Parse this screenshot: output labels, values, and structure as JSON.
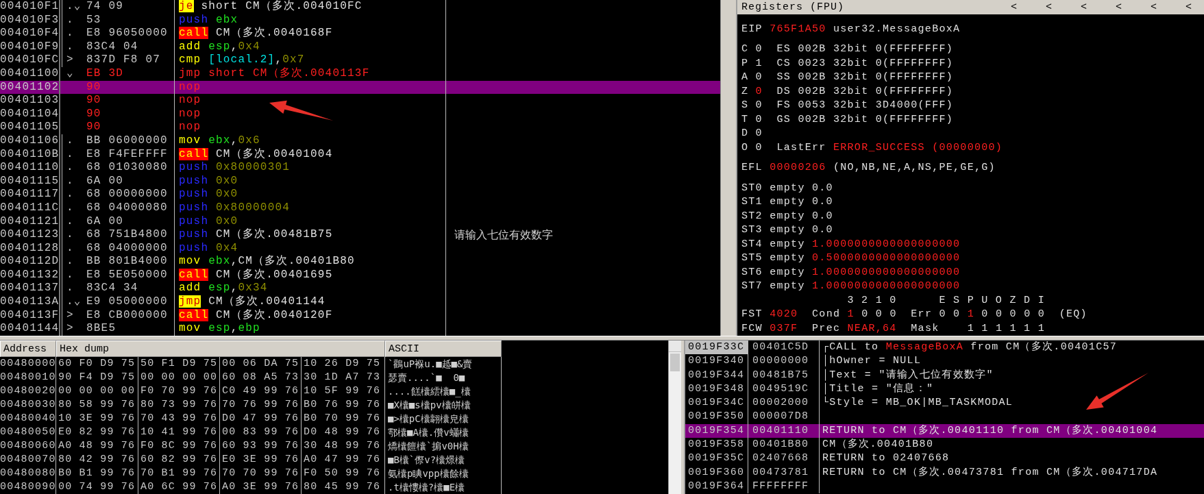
{
  "disasm": {
    "rows": [
      {
        "address": "004010F1",
        "mark": ".⌄",
        "bracket": true,
        "hex": "74 09",
        "modified": false,
        "selected": false,
        "tokens": [
          {
            "text": "je",
            "kind": "jump"
          },
          {
            "text": " short CM（多次.004010FC",
            "kind": "plain"
          }
        ]
      },
      {
        "address": "004010F3",
        "mark": ".",
        "bracket": true,
        "hex": "53",
        "modified": false,
        "selected": false,
        "tokens": [
          {
            "text": "push",
            "kind": "push"
          },
          {
            "text": " ebx",
            "kind": "reg"
          }
        ]
      },
      {
        "address": "004010F4",
        "mark": ".",
        "bracket": true,
        "hex": "E8 96050000",
        "modified": false,
        "selected": false,
        "tokens": [
          {
            "text": "call",
            "kind": "call"
          },
          {
            "text": " CM（多次.0040168F",
            "kind": "plain"
          }
        ]
      },
      {
        "address": "004010F9",
        "mark": ".",
        "bracket": true,
        "hex": "83C4 04",
        "modified": false,
        "selected": false,
        "tokens": [
          {
            "text": "add",
            "kind": "mnem"
          },
          {
            "text": " esp",
            "kind": "reg"
          },
          {
            "text": ",",
            "kind": "plain"
          },
          {
            "text": "0x4",
            "kind": "imm"
          }
        ]
      },
      {
        "address": "004010FC",
        "mark": ">",
        "bracket": true,
        "hex": "837D F8 07",
        "modified": false,
        "selected": false,
        "tokens": [
          {
            "text": "cmp",
            "kind": "mnem"
          },
          {
            "text": " [local.2]",
            "kind": "mem"
          },
          {
            "text": ",",
            "kind": "plain"
          },
          {
            "text": "0x7",
            "kind": "imm"
          }
        ]
      },
      {
        "address": "00401100",
        "mark": "⌄",
        "bracket": false,
        "hex": "EB 3D",
        "modified": true,
        "selected": false,
        "tokens": [
          {
            "text": "jmp short CM（多次.0040113F",
            "kind": "mod"
          }
        ]
      },
      {
        "address": "00401102",
        "bracket": false,
        "hex": "90",
        "modified": true,
        "selected": true,
        "tokens": [
          {
            "text": "nop",
            "kind": "mod"
          }
        ]
      },
      {
        "address": "00401103",
        "bracket": false,
        "hex": "90",
        "modified": true,
        "selected": false,
        "tokens": [
          {
            "text": "nop",
            "kind": "mod"
          }
        ]
      },
      {
        "address": "00401104",
        "bracket": false,
        "hex": "90",
        "modified": true,
        "selected": false,
        "tokens": [
          {
            "text": "nop",
            "kind": "mod"
          }
        ]
      },
      {
        "address": "00401105",
        "bracket": false,
        "hex": "90",
        "modified": true,
        "selected": false,
        "tokens": [
          {
            "text": "nop",
            "kind": "mod"
          }
        ]
      },
      {
        "address": "00401106",
        "mark": ".",
        "bracket": true,
        "hex": "BB 06000000",
        "modified": false,
        "selected": false,
        "tokens": [
          {
            "text": "mov",
            "kind": "mnem"
          },
          {
            "text": " ebx",
            "kind": "reg"
          },
          {
            "text": ",",
            "kind": "plain"
          },
          {
            "text": "0x6",
            "kind": "imm"
          }
        ]
      },
      {
        "address": "0040110B",
        "mark": ".",
        "bracket": true,
        "hex": "E8 F4FEFFFF",
        "modified": false,
        "selected": false,
        "tokens": [
          {
            "text": "call",
            "kind": "call"
          },
          {
            "text": " CM（多次.00401004",
            "kind": "plain"
          }
        ]
      },
      {
        "address": "00401110",
        "mark": ".",
        "bracket": true,
        "hex": "68 01030080",
        "modified": false,
        "selected": false,
        "tokens": [
          {
            "text": "push",
            "kind": "push"
          },
          {
            "text": " 0x80000301",
            "kind": "imm"
          }
        ]
      },
      {
        "address": "00401115",
        "mark": ".",
        "bracket": true,
        "hex": "6A 00",
        "modified": false,
        "selected": false,
        "tokens": [
          {
            "text": "push",
            "kind": "push"
          },
          {
            "text": " 0x0",
            "kind": "imm"
          }
        ]
      },
      {
        "address": "00401117",
        "mark": ".",
        "bracket": true,
        "hex": "68 00000000",
        "modified": false,
        "selected": false,
        "tokens": [
          {
            "text": "push",
            "kind": "push"
          },
          {
            "text": " 0x0",
            "kind": "imm"
          }
        ]
      },
      {
        "address": "0040111C",
        "mark": ".",
        "bracket": true,
        "hex": "68 04000080",
        "modified": false,
        "selected": false,
        "tokens": [
          {
            "text": "push",
            "kind": "push"
          },
          {
            "text": " 0x80000004",
            "kind": "imm"
          }
        ]
      },
      {
        "address": "00401121",
        "mark": ".",
        "bracket": true,
        "hex": "6A 00",
        "modified": false,
        "selected": false,
        "tokens": [
          {
            "text": "push",
            "kind": "push"
          },
          {
            "text": " 0x0",
            "kind": "imm"
          }
        ]
      },
      {
        "address": "00401123",
        "mark": ".",
        "bracket": true,
        "hex": "68 751B4800",
        "modified": false,
        "selected": false,
        "tokens": [
          {
            "text": "push",
            "kind": "push"
          },
          {
            "text": " CM（多次.00481B75",
            "kind": "plain"
          }
        ],
        "comment": "请输入七位有效数字"
      },
      {
        "address": "00401128",
        "mark": ".",
        "bracket": true,
        "hex": "68 04000000",
        "modified": false,
        "selected": false,
        "tokens": [
          {
            "text": "push",
            "kind": "push"
          },
          {
            "text": " 0x4",
            "kind": "imm"
          }
        ]
      },
      {
        "address": "0040112D",
        "mark": ".",
        "bracket": true,
        "hex": "BB 801B4000",
        "modified": false,
        "selected": false,
        "tokens": [
          {
            "text": "mov",
            "kind": "mnem"
          },
          {
            "text": " ebx",
            "kind": "reg"
          },
          {
            "text": ",CM（多次.00401B80",
            "kind": "plain"
          }
        ]
      },
      {
        "address": "00401132",
        "mark": ".",
        "bracket": true,
        "hex": "E8 5E050000",
        "modified": false,
        "selected": false,
        "tokens": [
          {
            "text": "call",
            "kind": "call"
          },
          {
            "text": " CM（多次.00401695",
            "kind": "plain"
          }
        ]
      },
      {
        "address": "00401137",
        "mark": ".",
        "bracket": true,
        "hex": "83C4 34",
        "modified": false,
        "selected": false,
        "tokens": [
          {
            "text": "add",
            "kind": "mnem"
          },
          {
            "text": " esp",
            "kind": "reg"
          },
          {
            "text": ",",
            "kind": "plain"
          },
          {
            "text": "0x34",
            "kind": "imm"
          }
        ]
      },
      {
        "address": "0040113A",
        "mark": ".⌄",
        "bracket": true,
        "hex": "E9 05000000",
        "modified": false,
        "selected": false,
        "tokens": [
          {
            "text": "jmp",
            "kind": "jump"
          },
          {
            "text": " CM（多次.00401144",
            "kind": "plain"
          }
        ]
      },
      {
        "address": "0040113F",
        "mark": ">",
        "bracket": true,
        "hex": "E8 CB000000",
        "modified": false,
        "selected": false,
        "tokens": [
          {
            "text": "call",
            "kind": "call"
          },
          {
            "text": " CM（多次.0040120F",
            "kind": "plain"
          }
        ]
      },
      {
        "address": "00401144",
        "mark": ">",
        "bracket": true,
        "hex": "8BE5",
        "modified": false,
        "selected": false,
        "tokens": [
          {
            "text": "mov",
            "kind": "mnem"
          },
          {
            "text": " esp",
            "kind": "reg"
          },
          {
            "text": ",",
            "kind": "plain"
          },
          {
            "text": "ebp",
            "kind": "reg"
          }
        ]
      }
    ]
  },
  "registers": {
    "title": "Registers (FPU)",
    "header_buttons": [
      "<",
      "<",
      "<",
      "<",
      "<",
      "<"
    ],
    "groups": [
      [
        [
          {
            "text": "EIP ",
            "kind": "plain"
          },
          {
            "text": "765F1A50",
            "kind": "changed"
          },
          {
            "text": " user32.MessageBoxA",
            "kind": "plain"
          }
        ]
      ],
      [
        [
          {
            "text": "C 0  ES 002B 32bit 0(FFFFFFFF)",
            "kind": "plain"
          }
        ],
        [
          {
            "text": "P 1  CS 0023 32bit 0(FFFFFFFF)",
            "kind": "plain"
          }
        ],
        [
          {
            "text": "A 0  SS 002B 32bit 0(FFFFFFFF)",
            "kind": "plain"
          }
        ],
        [
          {
            "text": "Z ",
            "kind": "plain"
          },
          {
            "text": "0",
            "kind": "changed"
          },
          {
            "text": "  DS 002B 32bit 0(FFFFFFFF)",
            "kind": "plain"
          }
        ],
        [
          {
            "text": "S 0  FS 0053 32bit 3D4000(FFF)",
            "kind": "plain"
          }
        ],
        [
          {
            "text": "T 0  GS 002B 32bit 0(FFFFFFFF)",
            "kind": "plain"
          }
        ],
        [
          {
            "text": "D 0",
            "kind": "plain"
          }
        ],
        [
          {
            "text": "O 0  LastErr ",
            "kind": "plain"
          },
          {
            "text": "ERROR_SUCCESS (00000000)",
            "kind": "changed"
          }
        ]
      ],
      [
        [
          {
            "text": "EFL ",
            "kind": "plain"
          },
          {
            "text": "00000206",
            "kind": "changed"
          },
          {
            "text": " (NO,NB,NE,A,NS,PE,GE,G)",
            "kind": "plain"
          }
        ]
      ],
      [
        [
          {
            "text": "ST0 empty 0.0",
            "kind": "plain"
          }
        ],
        [
          {
            "text": "ST1 empty 0.0",
            "kind": "plain"
          }
        ],
        [
          {
            "text": "ST2 empty 0.0",
            "kind": "plain"
          }
        ],
        [
          {
            "text": "ST3 empty 0.0",
            "kind": "plain"
          }
        ],
        [
          {
            "text": "ST4 empty ",
            "kind": "plain"
          },
          {
            "text": "1.0000000000000000000",
            "kind": "changed"
          }
        ],
        [
          {
            "text": "ST5 empty ",
            "kind": "plain"
          },
          {
            "text": "0.5000000000000000000",
            "kind": "changed"
          }
        ],
        [
          {
            "text": "ST6 empty ",
            "kind": "plain"
          },
          {
            "text": "1.0000000000000000000",
            "kind": "changed"
          }
        ],
        [
          {
            "text": "ST7 empty ",
            "kind": "plain"
          },
          {
            "text": "1.0000000000000000000",
            "kind": "changed"
          }
        ],
        [
          {
            "text": "               3 2 1 0      E S P U O Z D I",
            "kind": "plain"
          }
        ],
        [
          {
            "text": "FST ",
            "kind": "plain"
          },
          {
            "text": "4020",
            "kind": "changed"
          },
          {
            "text": "  Cond ",
            "kind": "plain"
          },
          {
            "text": "1",
            "kind": "changed"
          },
          {
            "text": " 0 0 0  Err 0 0 ",
            "kind": "plain"
          },
          {
            "text": "1",
            "kind": "changed"
          },
          {
            "text": " 0 0 0 0 0  (EQ)",
            "kind": "plain"
          }
        ],
        [
          {
            "text": "FCW ",
            "kind": "plain"
          },
          {
            "text": "037F",
            "kind": "changed"
          },
          {
            "text": "  Prec ",
            "kind": "plain"
          },
          {
            "text": "NEAR,64",
            "kind": "changed"
          },
          {
            "text": "  Mask    1 1 1 1 1 1",
            "kind": "plain"
          }
        ]
      ]
    ]
  },
  "dump": {
    "columns": [
      "Address",
      "Hex dump",
      "ASCII"
    ],
    "rows": [
      {
        "address": "00480000",
        "hex": [
          "60 F0 D9 75",
          "50 F1 D9 75",
          "00 06 DA 75",
          "10 26 D9 75"
        ],
        "ascii": "`鸛uP褓u.■趆■&賣"
      },
      {
        "address": "00480010",
        "hex": [
          "90 F4 D9 75",
          "00 00 00 00",
          "60 08 A5 73",
          "30 1D A7 73"
        ],
        "ascii": "瑟賣....`■  0■"
      },
      {
        "address": "00480020",
        "hex": [
          "00 00 00 00",
          "F0 70 99 76",
          "C0 49 99 76",
          "10 5F 99 76"
        ],
        "ascii": "....餻欜繧欜■_欜"
      },
      {
        "address": "00480030",
        "hex": [
          "80 58 99 76",
          "80 73 99 76",
          "70 76 99 76",
          "B0 76 99 76"
        ],
        "ascii": "■X欜■s欜pv欜皏欜"
      },
      {
        "address": "00480040",
        "hex": [
          "10 3E 99 76",
          "70 43 99 76",
          "D0 47 99 76",
          "B0 70 99 76"
        ],
        "ascii": "■>欜pC欜翿欜皃欜"
      },
      {
        "address": "00480050",
        "hex": [
          "E0 82 99 76",
          "10 41 99 76",
          "00 83 99 76",
          "D0 48 99 76"
        ],
        "ascii": "鄠欜■A欜.儹v蠨欜"
      },
      {
        "address": "00480060",
        "hex": [
          "A0 48 99 76",
          "F0 8C 99 76",
          "60 93 99 76",
          "30 48 99 76"
        ],
        "ascii": "燆欜饘欜`掮v0H欜"
      },
      {
        "address": "00480070",
        "hex": [
          "80 42 99 76",
          "60 82 99 76",
          "E0 3E 99 76",
          "A0 47 99 76"
        ],
        "ascii": "■B欜`傺v?欜燝欜"
      },
      {
        "address": "00480080",
        "hex": [
          "B0 B1 99 76",
          "70 B1 99 76",
          "70 70 99 76",
          "F0 50 99 76"
        ],
        "ascii": "氨欜p睓vpp欜餘欜"
      },
      {
        "address": "00480090",
        "hex": [
          "00 74 99 76",
          "A0 6C 99 76",
          "A0 3E 99 76",
          "80 45 99 76"
        ],
        "ascii": ".t欜慺欜?欜■E欜"
      }
    ]
  },
  "stack": {
    "rows": [
      {
        "address": "0019F33C",
        "value": "00401C5D",
        "highlighted": true,
        "selected": false,
        "tokens": [
          {
            "text": "┌CALL to ",
            "kind": "plain"
          },
          {
            "text": "MessageBoxA",
            "kind": "red"
          },
          {
            "text": " from CM（多次.00401C57",
            "kind": "plain"
          }
        ]
      },
      {
        "address": "0019F340",
        "value": "00000000",
        "highlighted": false,
        "selected": false,
        "tokens": [
          {
            "text": "│hOwner = NULL",
            "kind": "plain"
          }
        ]
      },
      {
        "address": "0019F344",
        "value": "00481B75",
        "highlighted": false,
        "selected": false,
        "tokens": [
          {
            "text": "│Text = \"请输入七位有效数字\"",
            "kind": "plain"
          }
        ]
      },
      {
        "address": "0019F348",
        "value": "0049519C",
        "highlighted": false,
        "selected": false,
        "tokens": [
          {
            "text": "│Title = \"信息：\"",
            "kind": "plain"
          }
        ]
      },
      {
        "address": "0019F34C",
        "value": "00002000",
        "highlighted": false,
        "selected": false,
        "tokens": [
          {
            "text": "└Style = MB_OK|MB_TASKMODAL",
            "kind": "plain"
          }
        ]
      },
      {
        "address": "0019F350",
        "value": "000007D8",
        "highlighted": false,
        "selected": false
      },
      {
        "address": "0019F354",
        "value": "00401110",
        "highlighted": false,
        "selected": true,
        "tokens": [
          {
            "text": "RETURN to CM（多次.00401110 from CM（多次.00401004",
            "kind": "plain"
          }
        ]
      },
      {
        "address": "0019F358",
        "value": "00401B80",
        "highlighted": false,
        "selected": false,
        "tokens": [
          {
            "text": "CM（多次.00401B80",
            "kind": "plain"
          }
        ]
      },
      {
        "address": "0019F35C",
        "value": "02407668",
        "highlighted": false,
        "selected": false,
        "tokens": [
          {
            "text": "RETURN to 02407668",
            "kind": "plain"
          }
        ]
      },
      {
        "address": "0019F360",
        "value": "00473781",
        "highlighted": false,
        "selected": false,
        "tokens": [
          {
            "text": "RETURN to CM（多次.00473781 from CM（多次.004717DA",
            "kind": "plain"
          }
        ]
      },
      {
        "address": "0019F364",
        "value": "FFFFFFFF",
        "highlighted": false,
        "selected": false
      }
    ]
  }
}
